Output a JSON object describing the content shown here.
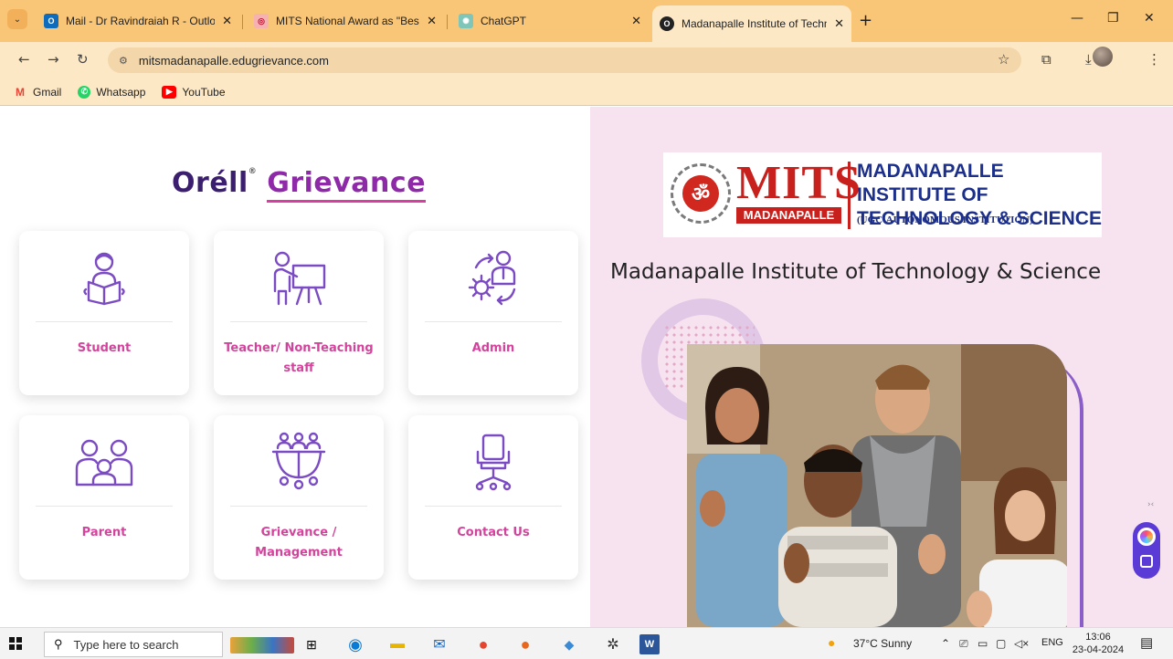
{
  "browser": {
    "tabs": [
      {
        "title": "Mail - Dr Ravindraiah R - Outlo",
        "icon": "outlook-icon"
      },
      {
        "title": "MITS National Award as \"Best",
        "icon": "award-icon"
      },
      {
        "title": "ChatGPT",
        "icon": "chatgpt-icon"
      },
      {
        "title": "Madanapalle Institute of Techn",
        "icon": "site-icon",
        "active": true
      }
    ],
    "url": "mitsmadanapalle.edugrievance.com",
    "bookmarks": [
      {
        "label": "Gmail",
        "icon": "gmail-icon"
      },
      {
        "label": "Whatsapp",
        "icon": "whatsapp-icon"
      },
      {
        "label": "YouTube",
        "icon": "youtube-icon"
      }
    ]
  },
  "page": {
    "brand": {
      "part1": "Orell",
      "accent": "é",
      "part1b": "ll",
      "part2": "Grievance",
      "reg": "®"
    },
    "cards": [
      {
        "label": "Student",
        "icon": "student-reading-icon"
      },
      {
        "label": "Teacher/ Non-Teaching staff",
        "icon": "teacher-board-icon"
      },
      {
        "label": "Admin",
        "icon": "admin-gear-icon"
      },
      {
        "label": "Parent",
        "icon": "parent-child-icon"
      },
      {
        "label": "Grievance / Management",
        "icon": "management-meeting-icon"
      },
      {
        "label": "Contact Us",
        "icon": "office-chair-icon"
      }
    ],
    "logo": {
      "mits": "MITS",
      "mits_sub": "MADANAPALLE",
      "name_line1": "MADANAPALLE INSTITUTE OF",
      "name_line2": "TECHNOLOGY & SCIENCE",
      "subtitle": "(UGC-AUTONOMOUS INSTITUTION)",
      "seal_glyph": "ॐ"
    },
    "institute_title": "Madanapalle Institute of Technology & Science"
  },
  "taskbar": {
    "search_placeholder": "Type here to search",
    "weather": "37°C  Sunny",
    "language": "ENG",
    "time": "13:06",
    "date": "23-04-2024"
  },
  "colors": {
    "tabbar": "#f9c576",
    "toolbar": "#fde8c6",
    "card_label": "#d2449b",
    "icon_stroke": "#7b4bc4",
    "right_pane": "#f7e3f0",
    "mits_red": "#c8201c",
    "mits_blue": "#1c2f8a"
  }
}
